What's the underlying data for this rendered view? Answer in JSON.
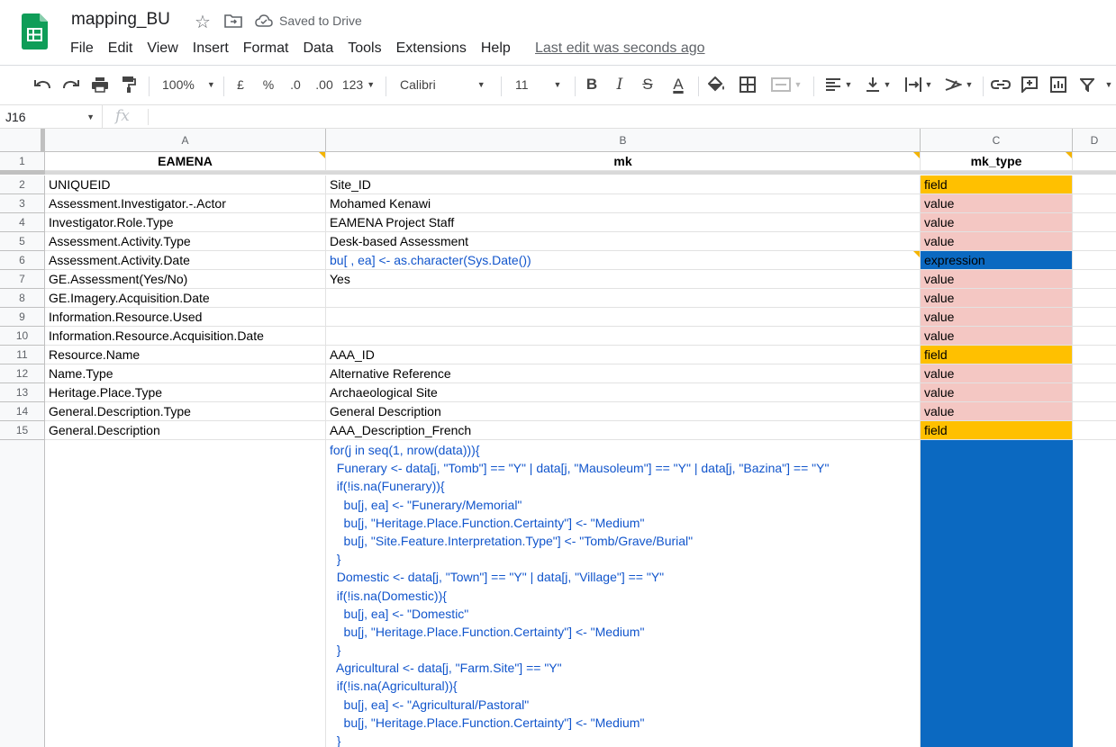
{
  "app": {
    "doc_title": "mapping_BU",
    "saved_status": "Saved to Drive",
    "last_edit": "Last edit was seconds ago",
    "brand_color": "#0f9d58"
  },
  "menu": [
    "File",
    "Edit",
    "View",
    "Insert",
    "Format",
    "Data",
    "Tools",
    "Extensions",
    "Help"
  ],
  "toolbar": {
    "zoom": "100%",
    "currency": "£",
    "percent": "%",
    "decrease_decimal": ".0",
    "increase_decimal": ".00",
    "more_formats": "123",
    "font": "Calibri",
    "font_size": "11",
    "bold": "B",
    "italic": "I",
    "strike": "S",
    "text_color": "A"
  },
  "formula_bar": {
    "name_box": "J16",
    "fx": "fx",
    "content": ""
  },
  "columns": [
    "A",
    "B",
    "C",
    "D"
  ],
  "rows": [
    {
      "n": "1",
      "a": "EAMENA",
      "b": "mk",
      "c": "mk_type",
      "c_type": "header"
    },
    {
      "n": "2",
      "a": "UNIQUEID",
      "b": "Site_ID",
      "c": "field",
      "c_type": "field"
    },
    {
      "n": "3",
      "a": "Assessment.Investigator.-.Actor",
      "b": "Mohamed Kenawi",
      "c": "value",
      "c_type": "value"
    },
    {
      "n": "4",
      "a": "Investigator.Role.Type",
      "b": "EAMENA Project Staff",
      "c": "value",
      "c_type": "value"
    },
    {
      "n": "5",
      "a": "Assessment.Activity.Type",
      "b": "Desk-based Assessment",
      "c": "value",
      "c_type": "value"
    },
    {
      "n": "6",
      "a": "Assessment.Activity.Date",
      "b": "bu[ , ea] <- as.character(Sys.Date())",
      "c": "expression",
      "c_type": "expression"
    },
    {
      "n": "7",
      "a": "GE.Assessment(Yes/No)",
      "b": "Yes",
      "c": "value",
      "c_type": "value"
    },
    {
      "n": "8",
      "a": "GE.Imagery.Acquisition.Date",
      "b": "",
      "c": "value",
      "c_type": "value"
    },
    {
      "n": "9",
      "a": "Information.Resource.Used",
      "b": "",
      "c": "value",
      "c_type": "value"
    },
    {
      "n": "10",
      "a": "Information.Resource.Acquisition.Date",
      "b": "",
      "c": "value",
      "c_type": "value"
    },
    {
      "n": "11",
      "a": "Resource.Name",
      "b": "AAA_ID",
      "c": "field",
      "c_type": "field"
    },
    {
      "n": "12",
      "a": "Name.Type",
      "b": "Alternative Reference",
      "c": "value",
      "c_type": "value"
    },
    {
      "n": "13",
      "a": "Heritage.Place.Type",
      "b": "Archaeological Site",
      "c": "value",
      "c_type": "value"
    },
    {
      "n": "14",
      "a": "General.Description.Type",
      "b": "General Description",
      "c": "value",
      "c_type": "value"
    },
    {
      "n": "15",
      "a": "General.Description",
      "b": "AAA_Description_French",
      "c": "field",
      "c_type": "field"
    }
  ],
  "code_cell": [
    "for(j in seq(1, nrow(data))){",
    "  Funerary <- data[j, \"Tomb\"] == \"Y\" | data[j, \"Mausoleum\"] == \"Y\" | data[j, \"Bazina\"] == \"Y\"",
    "  if(!is.na(Funerary)){",
    "    bu[j, ea] <- \"Funerary/Memorial\"",
    "    bu[j, \"Heritage.Place.Function.Certainty\"] <- \"Medium\"",
    "    bu[j, \"Site.Feature.Interpretation.Type\"] <- \"Tomb/Grave/Burial\"",
    "  }",
    "  Domestic <- data[j, \"Town\"] == \"Y\" | data[j, \"Village\"] == \"Y\"",
    "  if(!is.na(Domestic)){",
    "    bu[j, ea] <- \"Domestic\"",
    "    bu[j, \"Heritage.Place.Function.Certainty\"] <- \"Medium\"",
    "  }",
    "  Agricultural <- data[j, \"Farm.Site\"] == \"Y\"",
    "  if(!is.na(Agricultural)){",
    "    bu[j, ea] <- \"Agricultural/Pastoral\"",
    "    bu[j, \"Heritage.Place.Function.Certainty\"] <- \"Medium\"",
    "  }"
  ],
  "colors": {
    "field": "#ffc000",
    "value": "#f4c7c3",
    "expression": "#0b69c1",
    "link_text": "#1155cc"
  }
}
